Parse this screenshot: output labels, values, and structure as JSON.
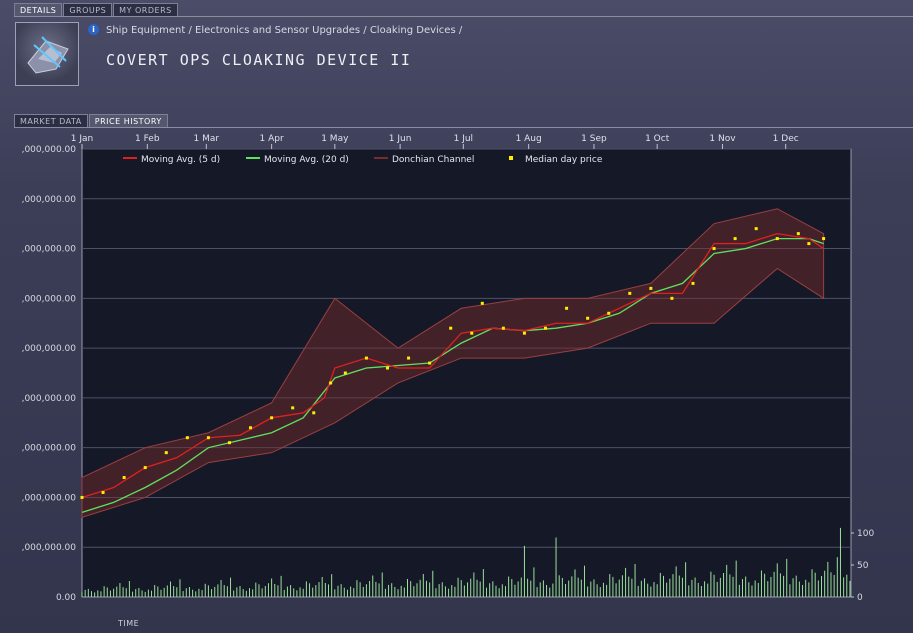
{
  "tabs": [
    {
      "label": "DETAILS",
      "active": true
    },
    {
      "label": "GROUPS",
      "active": false
    },
    {
      "label": "MY ORDERS",
      "active": false
    }
  ],
  "item": {
    "breadcrumb": "Ship Equipment / Electronics and Sensor Upgrades / Cloaking Devices /",
    "title": "COVERT OPS CLOAKING DEVICE II",
    "icon": "cloaking-device-icon",
    "info_icon": "i"
  },
  "subtabs": [
    {
      "label": "MARKET DATA",
      "active": false
    },
    {
      "label": "PRICE HISTORY",
      "active": true
    }
  ],
  "time_label": "TIME",
  "colors": {
    "ma5": "#e02020",
    "ma20": "#60e060",
    "donchian": "#7a2c2c",
    "median": "#ffee00",
    "volume": "#9be09b"
  },
  "chart_data": {
    "type": "line",
    "x_months": [
      "1 Jan",
      "1 Feb",
      "1 Mar",
      "1 Apr",
      "1 May",
      "1 Jun",
      "1 Jul",
      "1 Aug",
      "1 Sep",
      "1 Oct",
      "1 Nov",
      "1 Dec"
    ],
    "y_tick_labels": [
      "0.00",
      ",000,000.00",
      ",000,000.00",
      ",000,000.00",
      ",000,000.00",
      ",000,000.00",
      ",000,000.00",
      ",000,000.00",
      ",000,000.00",
      ",000,000.00"
    ],
    "y_tick_labels_top_first": [
      ",000,000.00",
      ",000,000.00",
      ",000,000.00",
      ",000,000.00",
      ",000,000.00",
      ",000,000.00",
      ",000,000.00",
      ",000,000.00",
      ",000,000.00",
      "0.00"
    ],
    "ylim": [
      0,
      9
    ],
    "volume_ticks": [
      "100",
      "50",
      "0"
    ],
    "volume_ylim": [
      0,
      100
    ],
    "legend": [
      "Moving Avg. (5 d)",
      "Moving Avg. (20 d)",
      "Donchian Channel",
      "Median day price"
    ],
    "legend_placement": "top",
    "grid": true,
    "series": [
      {
        "name": "Moving Avg. (20 d)",
        "points": [
          [
            0,
            1.7
          ],
          [
            15,
            1.9
          ],
          [
            30,
            2.2
          ],
          [
            45,
            2.55
          ],
          [
            60,
            3.0
          ],
          [
            75,
            3.15
          ],
          [
            90,
            3.3
          ],
          [
            105,
            3.6
          ],
          [
            120,
            4.4
          ],
          [
            135,
            4.6
          ],
          [
            150,
            4.65
          ],
          [
            165,
            4.7
          ],
          [
            180,
            5.1
          ],
          [
            195,
            5.4
          ],
          [
            210,
            5.35
          ],
          [
            225,
            5.4
          ],
          [
            240,
            5.5
          ],
          [
            255,
            5.7
          ],
          [
            270,
            6.1
          ],
          [
            285,
            6.3
          ],
          [
            300,
            6.9
          ],
          [
            315,
            7.0
          ],
          [
            330,
            7.2
          ],
          [
            345,
            7.2
          ],
          [
            352,
            7.1
          ]
        ]
      },
      {
        "name": "Moving Avg. (5 d)",
        "points": [
          [
            0,
            2.0
          ],
          [
            15,
            2.2
          ],
          [
            30,
            2.6
          ],
          [
            45,
            2.8
          ],
          [
            60,
            3.2
          ],
          [
            75,
            3.25
          ],
          [
            90,
            3.6
          ],
          [
            105,
            3.7
          ],
          [
            115,
            4.0
          ],
          [
            120,
            4.6
          ],
          [
            135,
            4.8
          ],
          [
            150,
            4.6
          ],
          [
            165,
            4.6
          ],
          [
            180,
            5.3
          ],
          [
            195,
            5.4
          ],
          [
            210,
            5.35
          ],
          [
            225,
            5.5
          ],
          [
            240,
            5.5
          ],
          [
            255,
            5.8
          ],
          [
            270,
            6.1
          ],
          [
            285,
            6.1
          ],
          [
            300,
            7.1
          ],
          [
            315,
            7.1
          ],
          [
            330,
            7.3
          ],
          [
            345,
            7.2
          ],
          [
            352,
            7.0
          ]
        ]
      },
      {
        "name": "Median day price",
        "points": [
          [
            0,
            2.0
          ],
          [
            10,
            2.1
          ],
          [
            20,
            2.4
          ],
          [
            30,
            2.6
          ],
          [
            40,
            2.9
          ],
          [
            50,
            3.2
          ],
          [
            60,
            3.2
          ],
          [
            70,
            3.1
          ],
          [
            80,
            3.4
          ],
          [
            90,
            3.6
          ],
          [
            100,
            3.8
          ],
          [
            110,
            3.7
          ],
          [
            118,
            4.3
          ],
          [
            125,
            4.5
          ],
          [
            135,
            4.8
          ],
          [
            145,
            4.6
          ],
          [
            155,
            4.8
          ],
          [
            165,
            4.7
          ],
          [
            175,
            5.4
          ],
          [
            185,
            5.3
          ],
          [
            190,
            5.9
          ],
          [
            200,
            5.4
          ],
          [
            210,
            5.3
          ],
          [
            220,
            5.4
          ],
          [
            230,
            5.8
          ],
          [
            240,
            5.6
          ],
          [
            250,
            5.7
          ],
          [
            260,
            6.1
          ],
          [
            270,
            6.2
          ],
          [
            280,
            6.0
          ],
          [
            290,
            6.3
          ],
          [
            300,
            7.0
          ],
          [
            310,
            7.2
          ],
          [
            320,
            7.4
          ],
          [
            330,
            7.2
          ],
          [
            340,
            7.3
          ],
          [
            345,
            7.1
          ],
          [
            352,
            7.2
          ]
        ]
      }
    ],
    "donchian_channel": [
      [
        0,
        1.6,
        2.4
      ],
      [
        30,
        2.0,
        3.0
      ],
      [
        60,
        2.7,
        3.3
      ],
      [
        90,
        2.9,
        3.9
      ],
      [
        120,
        3.5,
        6.0
      ],
      [
        150,
        4.3,
        5.0
      ],
      [
        180,
        4.8,
        5.8
      ],
      [
        210,
        4.8,
        6.0
      ],
      [
        240,
        5.0,
        6.0
      ],
      [
        270,
        5.5,
        6.3
      ],
      [
        300,
        5.5,
        7.5
      ],
      [
        330,
        6.6,
        7.8
      ],
      [
        352,
        6.0,
        7.3
      ]
    ],
    "volume_pattern": [
      15,
      22,
      12,
      25,
      18,
      30,
      14,
      20,
      26,
      17,
      32,
      22,
      28,
      19,
      35,
      24,
      30,
      21,
      40,
      28,
      33,
      25,
      45,
      30
    ]
  }
}
